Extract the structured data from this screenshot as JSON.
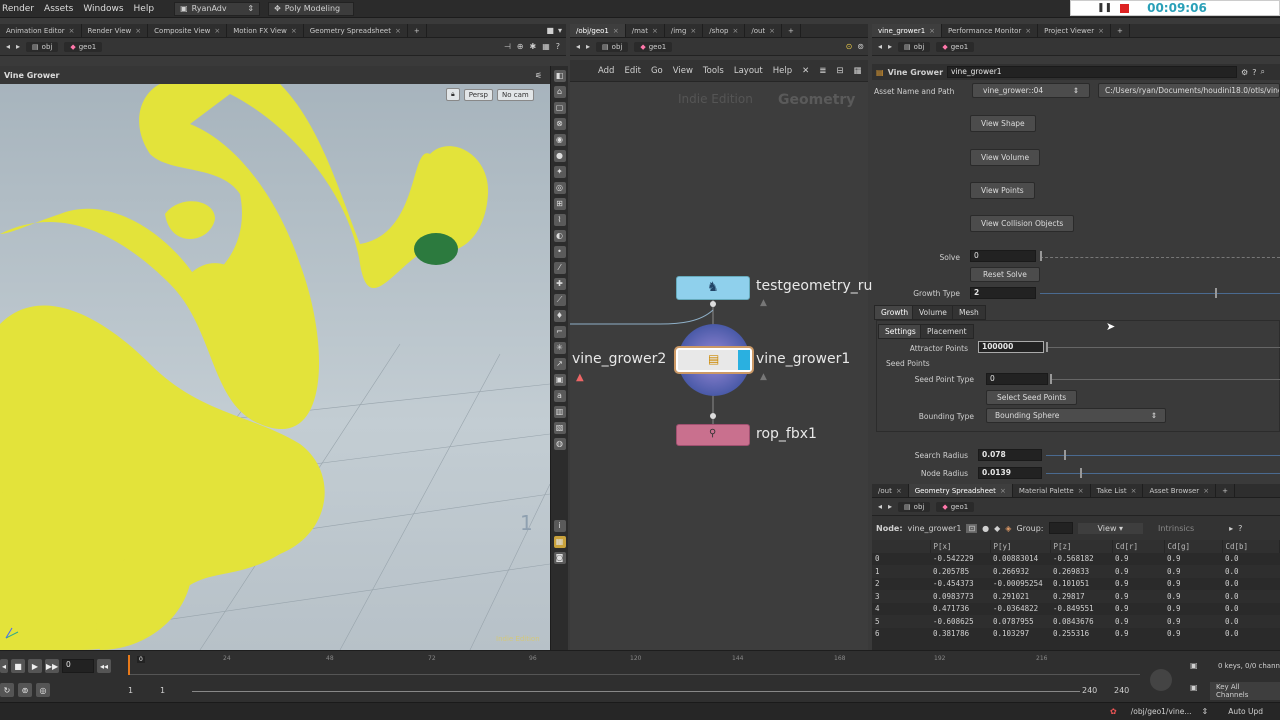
{
  "menubar": {
    "items": [
      "Render",
      "Assets",
      "Windows",
      "Help"
    ],
    "desktop": "RyanAdv",
    "layout": "Poly Modeling",
    "recorder_time": "00:09:06"
  },
  "left_tabs": [
    "Animation Editor",
    "Render View",
    "Composite View",
    "Motion FX View",
    "Geometry Spreadsheet"
  ],
  "mid_tabs": [
    "/obj/geo1",
    "/mat",
    "/img",
    "/shop",
    "/out"
  ],
  "right_tabs": [
    "vine_grower1",
    "Performance Monitor",
    "Project Viewer"
  ],
  "path": {
    "root": "obj",
    "node": "geo1"
  },
  "viewport": {
    "title": "Vine Grower",
    "persp": "Persp",
    "cam": "No cam",
    "watermark": "Indie Edition",
    "axis_num": "1"
  },
  "network": {
    "menu": [
      "Add",
      "Edit",
      "Go",
      "View",
      "Tools",
      "Layout",
      "Help"
    ],
    "watermark_left": "Indie Edition",
    "watermark_right": "Geometry",
    "nodes": {
      "testgeometry": "testgeometry_ru",
      "vine_grower1": "vine_grower1",
      "vine_grower2": "vine_grower2",
      "rop": "rop_fbx1"
    }
  },
  "params": {
    "node_type": "Vine Grower",
    "node_name": "vine_grower1",
    "asset_label": "Asset Name and Path",
    "asset_name": "vine_grower::04",
    "asset_path": "C:/Users/ryan/Documents/houdini18.0/otls/vine_",
    "buttons": [
      "View Shape",
      "View Volume",
      "View Points",
      "View Collision Objects"
    ],
    "solve_label": "Solve",
    "solve_value": "0",
    "reset_solve": "Reset Solve",
    "growth_type_label": "Growth Type",
    "growth_type_value": "2",
    "growth_type_fraction": 0.73,
    "tabs": [
      "Growth",
      "Volume",
      "Mesh"
    ],
    "subtabs": [
      "Settings",
      "Placement"
    ],
    "attractor_label": "Attractor Points",
    "attractor_value": "100000",
    "seed_points": "Seed Points",
    "seed_type_label": "Seed Point Type",
    "seed_type_value": "0",
    "select_seed": "Select Seed Points",
    "bounding_label": "Bounding Type",
    "bounding_value": "Bounding Sphere",
    "search_label": "Search Radius",
    "search_value": "0.078",
    "node_radius_label": "Node Radius",
    "node_radius_value": "0.0139"
  },
  "sheet": {
    "tabs": [
      "/out",
      "Geometry Spreadsheet",
      "Material Palette",
      "Take List",
      "Asset Browser"
    ],
    "node_label": "Node:",
    "node_name": "vine_grower1",
    "group_label": "Group:",
    "view_label": "View",
    "intrinsics": "Intrinsics",
    "columns": [
      "",
      "P[x]",
      "P[y]",
      "P[z]",
      "Cd[r]",
      "Cd[g]",
      "Cd[b]"
    ],
    "rows": [
      [
        "0",
        "-0.542229",
        "0.00883014",
        "-0.568182",
        "0.9",
        "0.9",
        "0.0"
      ],
      [
        "1",
        "0.205785",
        "0.266932",
        "0.269833",
        "0.9",
        "0.9",
        "0.0"
      ],
      [
        "2",
        "-0.454373",
        "-0.00095254",
        "0.101051",
        "0.9",
        "0.9",
        "0.0"
      ],
      [
        "3",
        "0.0983773",
        "0.291021",
        "0.29817",
        "0.9",
        "0.9",
        "0.0"
      ],
      [
        "4",
        "0.471736",
        "-0.0364822",
        "-0.849551",
        "0.9",
        "0.9",
        "0.0"
      ],
      [
        "5",
        "-0.608625",
        "0.0787955",
        "0.0843676",
        "0.9",
        "0.9",
        "0.0"
      ],
      [
        "6",
        "0.381786",
        "0.103297",
        "0.255316",
        "0.9",
        "0.9",
        "0.0"
      ]
    ]
  },
  "timeline": {
    "current_frame": "0",
    "marker": "0",
    "ticks": [
      "24",
      "48",
      "72",
      "96",
      "120",
      "144",
      "168",
      "192",
      "216"
    ],
    "start1": "1",
    "start2": "1",
    "end1": "240",
    "end2": "240",
    "keys_info": "0 keys, 0/0 chann",
    "key_all": "Key All Channels",
    "status_path": "/obj/geo1/vine...",
    "auto_update": "Auto Upd"
  }
}
